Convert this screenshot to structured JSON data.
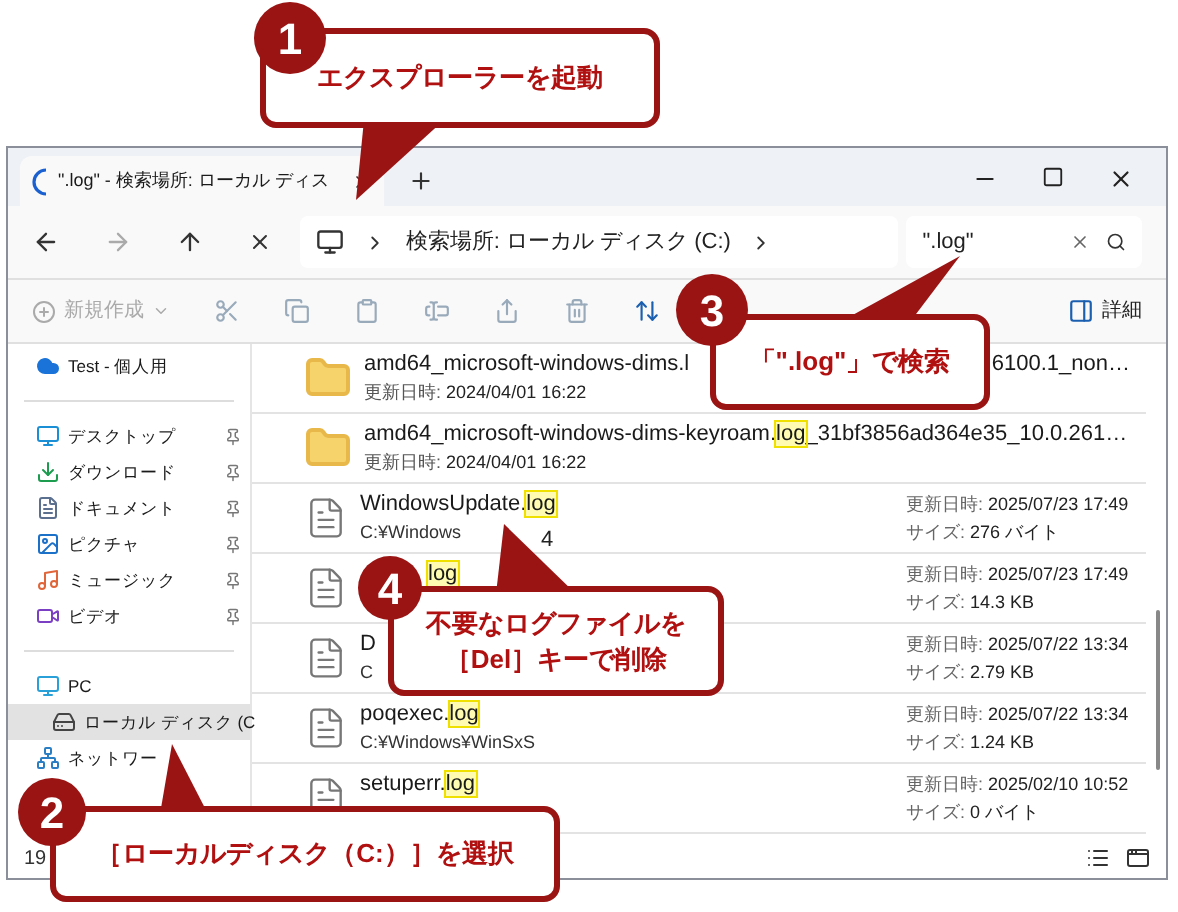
{
  "window": {
    "tab_title": "\".log\" - 検索場所: ローカル ディス",
    "address": "検索場所: ローカル ディスク (C:)",
    "search": {
      "value": "\".log\""
    }
  },
  "toolbar": {
    "new_label": "新規作成",
    "details_label": "詳細"
  },
  "sidebar": {
    "items": [
      {
        "kind": "cloud",
        "label": "Test - 個人用",
        "pinned": false,
        "selected": false,
        "divider_before": false
      },
      {
        "kind": "desktop",
        "label": "デスクトップ",
        "pinned": true,
        "selected": false,
        "divider_before": true
      },
      {
        "kind": "downloads",
        "label": "ダウンロード",
        "pinned": true,
        "selected": false,
        "divider_before": false
      },
      {
        "kind": "documents",
        "label": "ドキュメント",
        "pinned": true,
        "selected": false,
        "divider_before": false
      },
      {
        "kind": "pictures",
        "label": "ピクチャ",
        "pinned": true,
        "selected": false,
        "divider_before": false
      },
      {
        "kind": "music",
        "label": "ミュージック",
        "pinned": true,
        "selected": false,
        "divider_before": false
      },
      {
        "kind": "video",
        "label": "ビデオ",
        "pinned": true,
        "selected": false,
        "divider_before": false
      },
      {
        "kind": "pc",
        "label": "PC",
        "pinned": false,
        "selected": false,
        "divider_before": true
      },
      {
        "kind": "drive",
        "label": "ローカル ディスク (C",
        "pinned": false,
        "selected": true,
        "divider_before": false
      },
      {
        "kind": "network",
        "label": "ネットワー",
        "pinned": false,
        "selected": false,
        "divider_before": false
      }
    ]
  },
  "results": [
    {
      "kind": "folder",
      "name": "amd64_microsoft-windows-dims.l",
      "tail": "6100.1_non…",
      "sub_label": "更新日時:",
      "sub": "2024/04/01 16:22"
    },
    {
      "kind": "folder",
      "name": "amd64_microsoft-windows-dims-keyroam.",
      "match": "log",
      "rest": "_31bf3856ad364e35_10.0.261…",
      "sub_label": "更新日時:",
      "sub": "2024/04/01 16:22"
    },
    {
      "kind": "file",
      "name": "WindowsUpdate.",
      "match": "log",
      "path": "C:¥Windows",
      "extra": "4",
      "modified_label": "更新日時:",
      "modified": "2025/07/23 17:49",
      "size_label": "サイズ:",
      "size": "276 バイト"
    },
    {
      "kind": "file",
      "match": "log",
      "modified_label": "更新日時:",
      "modified": "2025/07/23 17:49",
      "size_label": "サイズ:",
      "size": "14.3 KB"
    },
    {
      "kind": "file",
      "name": "D",
      "path": "C",
      "modified_label": "更新日時:",
      "modified": "2025/07/22 13:34",
      "size_label": "サイズ:",
      "size": "2.79 KB"
    },
    {
      "kind": "file",
      "name": "poqexec.",
      "match": "log",
      "path": "C:¥Windows¥WinSxS",
      "modified_label": "更新日時:",
      "modified": "2025/07/22 13:34",
      "size_label": "サイズ:",
      "size": "1.24 KB"
    },
    {
      "kind": "file",
      "name": "setuperr.",
      "match": "log",
      "modified_label": "更新日時:",
      "modified": "2025/02/10 10:52",
      "size_label": "サイズ:",
      "size": "0 バイト"
    }
  ],
  "status_bar": {
    "count": "19"
  },
  "callouts": [
    {
      "number": "1",
      "lines": [
        "エクスプローラーを起動"
      ]
    },
    {
      "number": "3",
      "lines": [
        "「\".log\"」で検索"
      ]
    },
    {
      "number": "4",
      "lines": [
        "不要なログファイルを",
        "［Del］キーで削除"
      ]
    },
    {
      "number": "2",
      "lines": [
        "［ローカルディスク（C:）］を選択"
      ]
    }
  ]
}
